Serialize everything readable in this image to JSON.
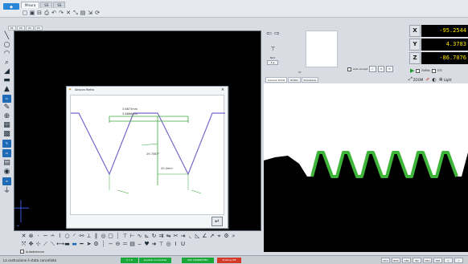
{
  "window": {
    "tabs": [
      {
        "label": "Misura",
        "active": true
      },
      {
        "label": "SS",
        "active": false
      },
      {
        "label": "SS",
        "active": false
      }
    ]
  },
  "view_tabs": [
    "P1",
    "X4",
    "A3",
    "X3"
  ],
  "popup": {
    "title": "Altezza filetto",
    "dim_a": "3.6873mm",
    "dim_b": "3.6866mm",
    "angle": "29.7583°",
    "depth": "20.4mm",
    "ok_label": "↵"
  },
  "bottom_toolbar": {
    "grid_label": "Autodistanza"
  },
  "navigation": {
    "unit_label": "Mod",
    "xy_label": "XY",
    "list_items": []
  },
  "coordinates": [
    {
      "axis": "X",
      "value": "-95.2544"
    },
    {
      "axis": "Y",
      "value": "4.3783"
    },
    {
      "axis": "Z",
      "value": "-86.7076"
    }
  ],
  "controls": {
    "auto_accept": "Auto Accept",
    "run_a": "RilMis",
    "run_b": "STC"
  },
  "camera": {
    "tabs": [
      {
        "label": "Camera #1VR",
        "active": true
      },
      {
        "label": "Profilo",
        "active": false
      },
      {
        "label": "Scansione",
        "active": false
      }
    ],
    "zoom_label": "ZOOM",
    "light_label": "Light",
    "profile_color": "#3fb43a"
  },
  "status": {
    "message": "La costruzione è stata cancellata",
    "badges": [
      {
        "label": "X Y Z",
        "color": "#1aa83a"
      },
      {
        "label": "Joystick Connected",
        "color": "#1aa83a"
      },
      {
        "label": "MIC CONNECTED",
        "color": "#1aa83a"
      },
      {
        "label": "Probing Off",
        "color": "#d43a2a"
      }
    ],
    "right_items": [
      "MCS",
      "RMS",
      "ABS",
      "INC",
      "DEG",
      "MM",
      "C",
      "?"
    ]
  },
  "colors": {
    "coordinate_text": "#ffe600",
    "accent_blue": "#1f6bb5"
  }
}
